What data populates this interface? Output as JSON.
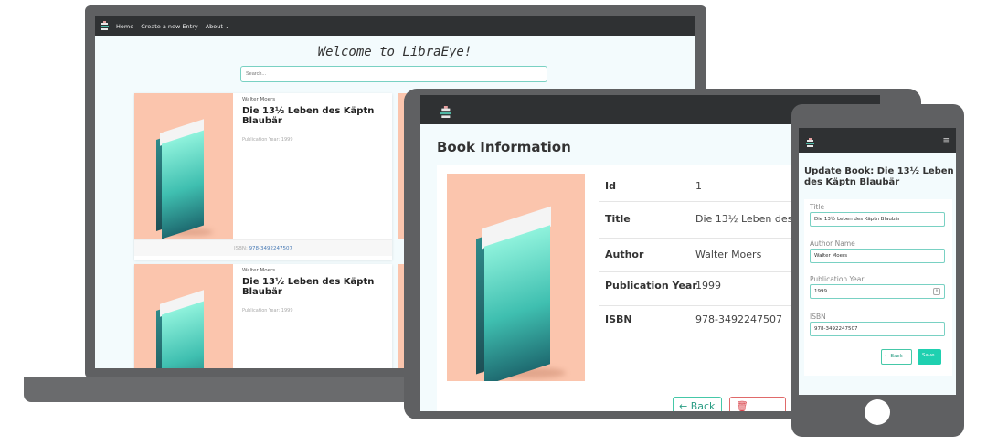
{
  "laptop": {
    "nav": {
      "home": "Home",
      "create": "Create a new Entry",
      "about": "About ⌄"
    },
    "title": "Welcome to LibraEye!",
    "search_placeholder": "Search...",
    "cards": [
      {
        "author": "Walter Moers",
        "title": "Die 13½ Leben des Käptn Blaubär",
        "year": "Publication Year: 1999",
        "isbn_label": "ISBN:",
        "isbn": "978-3492247507"
      },
      {
        "author": "Walter Moers",
        "title": "Die 13½ Leben des Käptn Blaubär",
        "year": "Publication Year: 1999"
      }
    ]
  },
  "tablet": {
    "title": "Book Information",
    "rows": [
      {
        "key": "Id",
        "value": "1"
      },
      {
        "key": "Title",
        "value": "Die 13½ Leben des Käptn Blaubär"
      },
      {
        "key": "Author",
        "value": "Walter Moers"
      },
      {
        "key": "Publication Year",
        "value": "1999"
      },
      {
        "key": "ISBN",
        "value": "978-3492247507"
      }
    ],
    "back_label": "← Back",
    "delete_label": "🗑 Delete"
  },
  "phone": {
    "menu_icon": "≡",
    "title": "Update Book: Die 13½ Leben des Käptn Blaubär",
    "fields": [
      {
        "label": "Title",
        "value": "Die 13½ Leben des Käptn Blaubär"
      },
      {
        "label": "Author Name",
        "value": "Walter Moers"
      },
      {
        "label": "Publication Year",
        "value": "1999"
      },
      {
        "label": "ISBN",
        "value": "978-3492247507"
      }
    ],
    "back_label": "← Back",
    "save_label": "Save"
  },
  "colors": {
    "accent": "#1fd0b0",
    "cover": "#fbc5ad",
    "nav": "#2f3133",
    "danger": "#d9434a"
  }
}
